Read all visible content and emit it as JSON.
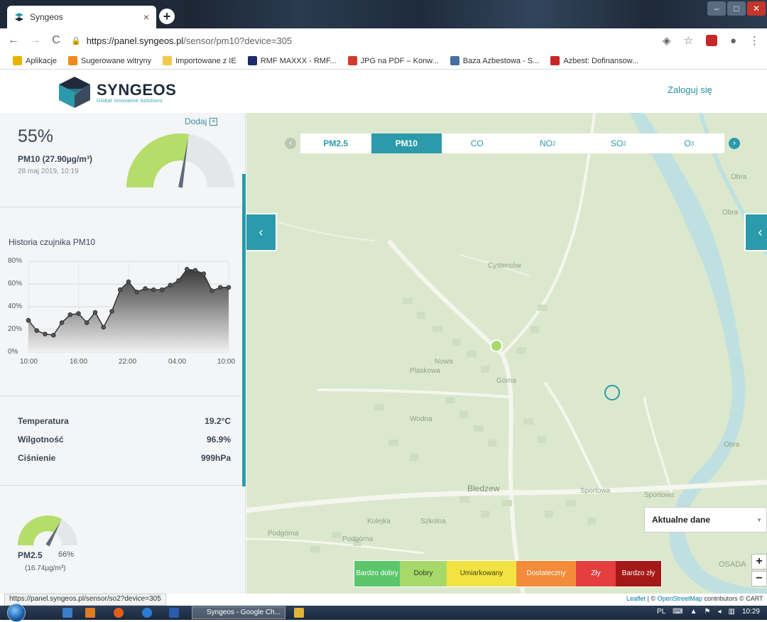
{
  "browser": {
    "tab_title": "Syngeos",
    "tab_close": "×",
    "new_tab": "+",
    "url_host": "https://panel.syngeos.pl",
    "url_path": "/sensor/pm10?device=305",
    "bookmarks": [
      {
        "label": "Aplikacje",
        "color": "#e8b400"
      },
      {
        "label": "Sugerowane witryny",
        "color": "#f08a1c"
      },
      {
        "label": "Importowane z IE",
        "color": "#f2c94c"
      },
      {
        "label": "RMF MAXXX - RMF...",
        "color": "#1c2b6b"
      },
      {
        "label": "JPG na PDF – Konw...",
        "color": "#d23b2c"
      },
      {
        "label": "Baza Azbestowa - S...",
        "color": "#4a6fa5"
      },
      {
        "label": "Azbest: Dofinansow...",
        "color": "#c62828"
      }
    ]
  },
  "header": {
    "logo_title": "SYNGEOS",
    "logo_subtitle": "Global Innovative Solutions",
    "login": "Zaloguj się"
  },
  "sidebar": {
    "add_label": "Dodaj",
    "main_gauge": {
      "percent": "55%",
      "metric": "PM10 (27.90µg/m³)",
      "date": "28 maj 2019, 10:19",
      "level": 0.55,
      "color": "#b5dd6a"
    },
    "history_title": "Historia czujnika PM10",
    "history_y_ticks": [
      "80%",
      "60%",
      "40%",
      "20%",
      "0%"
    ],
    "history_x_ticks": [
      "10:00",
      "16:00",
      "22:00",
      "04:00",
      "10:00"
    ],
    "env": [
      {
        "label": "Temperatura",
        "value": "19.2°C"
      },
      {
        "label": "Wilgotność",
        "value": "96.9%"
      },
      {
        "label": "Ciśnienie",
        "value": "999hPa"
      }
    ],
    "pm25": {
      "name": "PM2.5",
      "percent": "66%",
      "value": "(16.74µg/m³)",
      "level": 0.66,
      "color": "#b5dd6a"
    }
  },
  "chart_data": {
    "type": "area",
    "title": "Historia czujnika PM10",
    "xlabel": "",
    "ylabel": "",
    "x_tick_labels": [
      "10:00",
      "16:00",
      "22:00",
      "04:00",
      "10:00"
    ],
    "ylim": [
      0,
      80
    ],
    "series": [
      {
        "values": [
          28,
          19,
          16,
          15,
          26,
          33,
          34,
          26,
          35,
          22,
          36,
          55,
          62,
          53,
          56,
          55,
          55,
          59,
          63,
          73,
          72,
          69,
          54,
          57,
          57
        ]
      }
    ]
  },
  "map": {
    "tabs": [
      {
        "label": "PM2.5",
        "sub": "",
        "active": false
      },
      {
        "label": "PM10",
        "sub": "",
        "active": true
      },
      {
        "label": "CO",
        "sub": "",
        "active": false
      },
      {
        "label": "NO",
        "sub": "2",
        "active": false
      },
      {
        "label": "SO",
        "sub": "2",
        "active": false
      },
      {
        "label": "O",
        "sub": "3",
        "active": false
      }
    ],
    "labels": {
      "town": "Bledzew",
      "osada": "OSADA",
      "obra1": "Obra",
      "obra2": "Obra",
      "obra3": "Obra",
      "sportowa1": "Sportowa",
      "sportowa2": "Sportowa",
      "podgorna1": "Podgórna",
      "podgorna2": "Podgórna",
      "wodna": "Wodna",
      "gorna": "Górna",
      "nowa": "Nowa",
      "cystersow": "Cystersów",
      "plaskowa": "Plaskowa",
      "szkolna": "Szkolna",
      "kolejka": "Kolejka"
    },
    "legend": [
      {
        "label": "Bardzo dobry",
        "color": "#5bc56b"
      },
      {
        "label": "Dobry",
        "color": "#a7d96a"
      },
      {
        "label": "Umiarkowany",
        "color": "#f2e342"
      },
      {
        "label": "Dostateczny",
        "color": "#f28c3a"
      },
      {
        "label": "Zły",
        "color": "#e53e3e"
      },
      {
        "label": "Bardzo zły",
        "color": "#a51818"
      }
    ],
    "data_select": "Aktualne dane",
    "zoom_in": "+",
    "zoom_out": "−",
    "attribution_leaflet": "Leaflet",
    "attribution_text": " | © ",
    "attribution_osm": "OpenStreetMap",
    "attribution_rest": " contributors © CART"
  },
  "status_url": "https://panel.syngeos.pl/sensor/so2?device=305",
  "taskbar": {
    "task_label": "Syngeos - Google Ch...",
    "lang": "PL",
    "time": "10:29"
  },
  "colors": {
    "accent": "#2b9aab",
    "dark": "#3b4656"
  }
}
